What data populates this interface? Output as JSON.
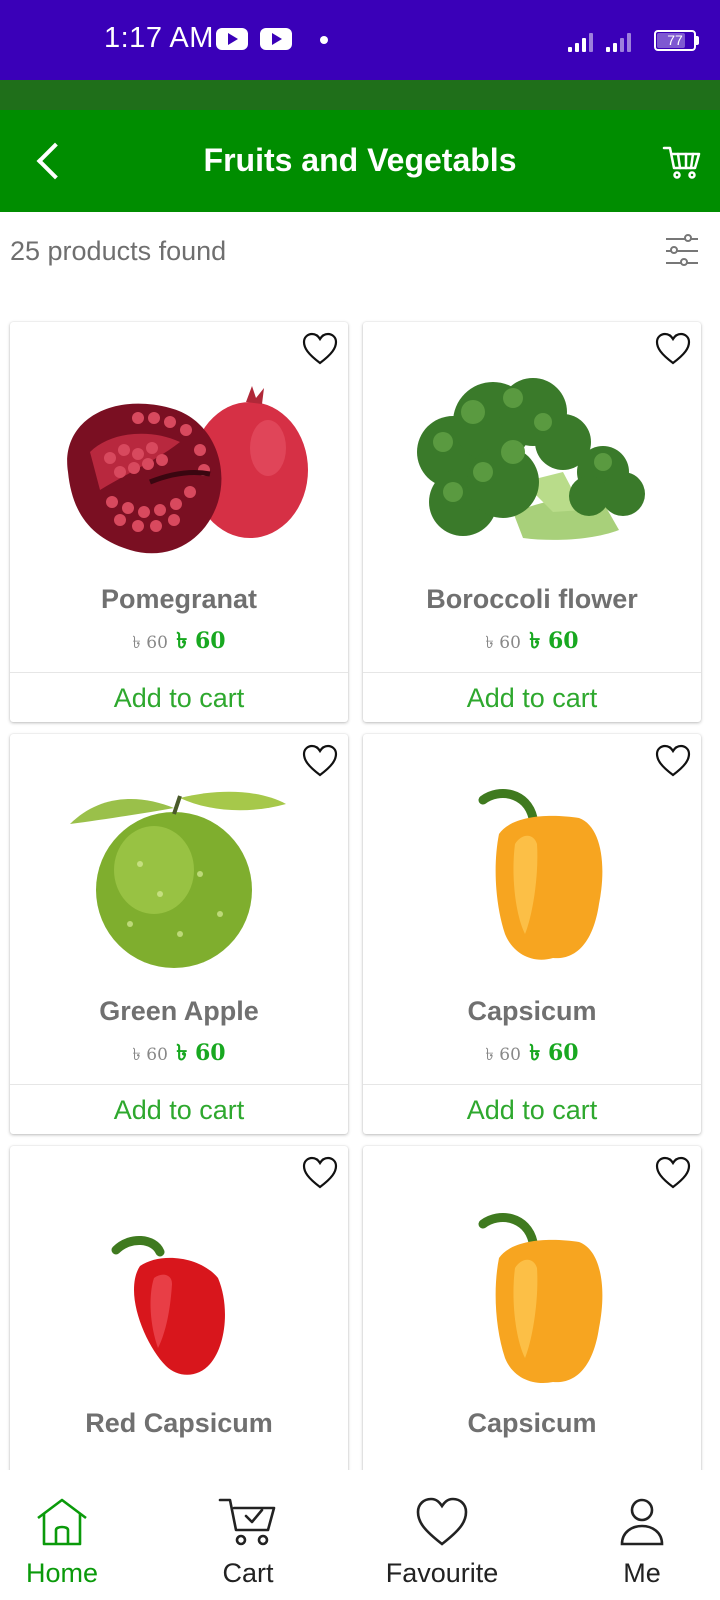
{
  "status_bar": {
    "time": "1:17 AM",
    "battery": "77",
    "icons": [
      "youtube-icon",
      "youtube-icon",
      "dot-icon",
      "signal-icon",
      "signal-icon",
      "battery-icon"
    ]
  },
  "app_bar": {
    "title": "Fruits and Vegetabls",
    "back_icon": "chevron-left-icon",
    "cart_icon": "cart-icon"
  },
  "results": {
    "count_text": "25 products found",
    "filter_icon": "sliders-icon"
  },
  "products": [
    {
      "name": "Pomegranat",
      "old_price": "৳ 60",
      "price": "৳ 60",
      "action": "Add to cart"
    },
    {
      "name": "Boroccoli flower",
      "old_price": "৳ 60",
      "price": "৳ 60",
      "action": "Add to cart"
    },
    {
      "name": "Green Apple",
      "old_price": "৳ 60",
      "price": "৳ 60",
      "action": "Add to cart"
    },
    {
      "name": "Capsicum",
      "old_price": "৳ 60",
      "price": "৳ 60",
      "action": "Add to cart"
    },
    {
      "name": "Red Capsicum",
      "old_price": "",
      "price": "",
      "action": ""
    },
    {
      "name": "Capsicum",
      "old_price": "",
      "price": "",
      "action": ""
    }
  ],
  "bottom_nav": {
    "items": [
      {
        "label": "Home",
        "icon": "home-icon",
        "active": true
      },
      {
        "label": "Cart",
        "icon": "cart-icon",
        "active": false
      },
      {
        "label": "Favourite",
        "icon": "heart-icon",
        "active": false
      },
      {
        "label": "Me",
        "icon": "user-icon",
        "active": false
      }
    ]
  },
  "colors": {
    "status_bar": "#3a00b8",
    "app_bar": "#008d00",
    "strip": "#1f6f1a",
    "accent_green": "#18a820",
    "text_gray": "#707070"
  }
}
